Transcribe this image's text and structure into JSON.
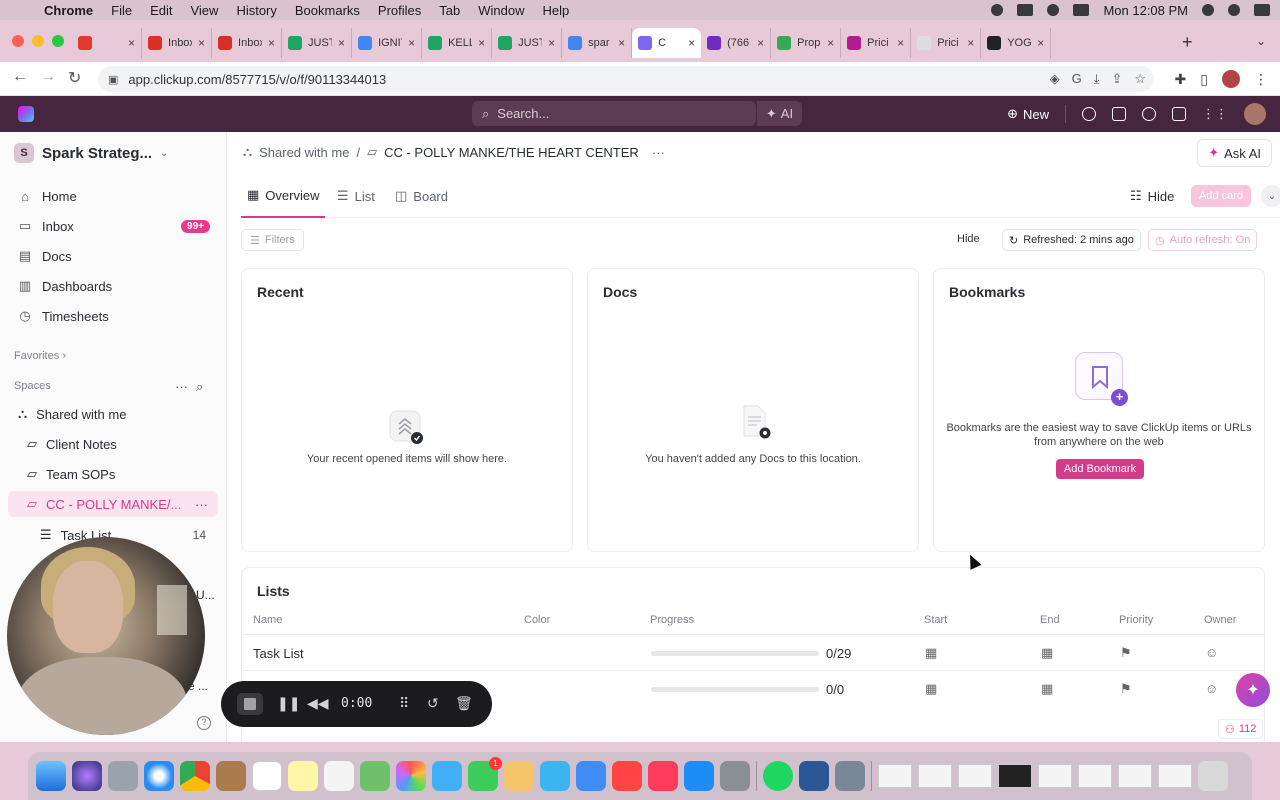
{
  "menubar": {
    "app": "Chrome",
    "items": [
      "File",
      "Edit",
      "View",
      "History",
      "Bookmarks",
      "Profiles",
      "Tab",
      "Window",
      "Help"
    ],
    "clock": "Mon 12:08 PM"
  },
  "browser": {
    "tabs": [
      {
        "title": "",
        "color": "#e23b2e"
      },
      {
        "title": "Inbox",
        "color": "#d93025"
      },
      {
        "title": "Inbox",
        "color": "#d93025"
      },
      {
        "title": "JUST",
        "color": "#1fa463"
      },
      {
        "title": "IGNIT",
        "color": "#4285f4"
      },
      {
        "title": "KELL",
        "color": "#1fa463"
      },
      {
        "title": "JUST",
        "color": "#1fa463"
      },
      {
        "title": "spar",
        "color": "#4285f4"
      },
      {
        "title": "C",
        "color": "#7b68ee",
        "active": true
      },
      {
        "title": "(766",
        "color": "#6f2dbd"
      },
      {
        "title": "Prop",
        "color": "#34a853"
      },
      {
        "title": "Prici",
        "color": "#b31b8f"
      },
      {
        "title": "Prici",
        "color": "#dddddd"
      },
      {
        "title": "YOG",
        "color": "#222222"
      }
    ],
    "url": "app.clickup.com/8577715/v/o/f/90113344013"
  },
  "topbar": {
    "search_placeholder": "Search...",
    "ai_label": "AI",
    "new_label": "New"
  },
  "sidebar": {
    "workspace_initial": "S",
    "workspace_name": "Spark Strateg...",
    "nav": [
      {
        "label": "Home",
        "icon": "home-icon"
      },
      {
        "label": "Inbox",
        "icon": "inbox-icon",
        "badge": "99+"
      },
      {
        "label": "Docs",
        "icon": "docs-icon"
      },
      {
        "label": "Dashboards",
        "icon": "dashboard-icon"
      },
      {
        "label": "Timesheets",
        "icon": "timer-icon"
      }
    ],
    "favorites_label": "Favorites",
    "spaces_label": "Spaces",
    "tree": [
      {
        "label": "Shared with me"
      },
      {
        "label": "Client Notes"
      },
      {
        "label": "Team SOPs"
      },
      {
        "label": "CC - POLLY MANKE/...",
        "active": true
      },
      {
        "label": "Task List",
        "count": "14"
      }
    ],
    "partial_1": "U...",
    "partial_2": "e ..."
  },
  "main": {
    "breadcrumb_shared": "Shared with me",
    "breadcrumb_sep": "/",
    "breadcrumb_current": "CC - POLLY MANKE/THE HEART CENTER",
    "ask_ai": "Ask AI",
    "tabs": [
      "Overview",
      "List",
      "Board"
    ],
    "hide_label": "Hide",
    "add_card": "Add card",
    "filters": "Filters",
    "hide_small": "Hide",
    "refreshed": "Refreshed: 2 mins ago",
    "auto_refresh": "Auto refresh: On",
    "cards": {
      "recent_title": "Recent",
      "recent_empty": "Your recent opened items will show here.",
      "docs_title": "Docs",
      "docs_empty": "You haven't added any Docs to this location.",
      "bookmarks_title": "Bookmarks",
      "bookmarks_text": "Bookmarks are the easiest way to save ClickUp items or URLs from anywhere on the web",
      "bookmarks_button": "Add Bookmark"
    },
    "lists": {
      "title": "Lists",
      "columns": [
        "Name",
        "Color",
        "Progress",
        "Start",
        "End",
        "Priority",
        "Owner"
      ],
      "rows": [
        {
          "name": "Task List",
          "progress_text": "0/29",
          "progress": 0
        },
        {
          "name": "",
          "progress_text": "0/0",
          "progress": 0
        }
      ]
    }
  },
  "recorder": {
    "time": "0:00"
  },
  "counter": "112",
  "accent": "#d63a8b"
}
